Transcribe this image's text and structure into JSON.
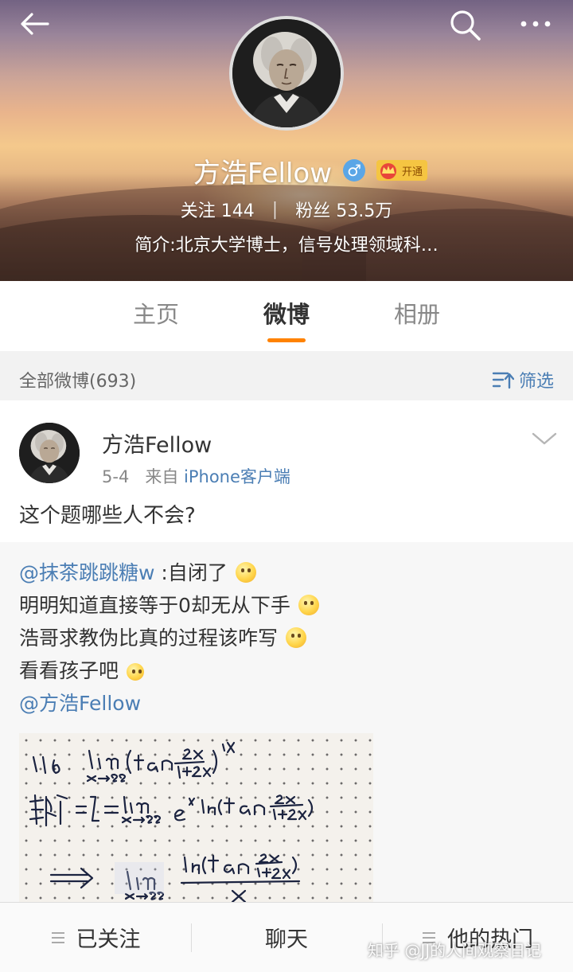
{
  "header": {
    "back_icon": "arrow-left-icon",
    "search_icon": "search-icon",
    "more_icon": "more-horizontal-icon",
    "user_name": "方浩Fellow",
    "gender_symbol": "♂",
    "vip_label": "开通",
    "following_label": "关注",
    "following_count": "144",
    "divider": "|",
    "followers_label": "粉丝",
    "followers_count": "53.5万",
    "bio": "简介:北京大学博士，信号处理领域科…"
  },
  "tabs": [
    {
      "label": "主页",
      "active": false
    },
    {
      "label": "微博",
      "active": true
    },
    {
      "label": "相册",
      "active": false
    }
  ],
  "filter": {
    "all_posts_label": "全部微博(693)",
    "filter_label": "筛选"
  },
  "post": {
    "author": "方浩Fellow",
    "date": "5-4",
    "source_prefix": "来自",
    "source": "iPhone客户端",
    "text": "这个题哪些人不会?",
    "repost": {
      "mention_user": "@抹茶跳跳糖w",
      "line1_text": ":自闭了",
      "line2": "明明知道直接等于0却无从下手",
      "line3": "浩哥求教伪比真的过程该咋写",
      "line4": "看看孩子吧",
      "mention_author": "@方浩Fellow"
    },
    "image": {
      "line1": "1.16. lim (tan 2πx/(1+2x))^(1/x)",
      "line1_sub": "x→∞",
      "line2": "解: I = lim e^(1/x · ln(tan πx/(1+2x)))",
      "line2_sub": "x→∞",
      "line3": "⇒ lim ln(tan πx/(1+2x)) / x",
      "line3_sub": "x→∞"
    }
  },
  "bottom_bar": {
    "followed_label": "已关注",
    "chat_label": "聊天",
    "hot_label": "他的热门"
  },
  "watermark": "知乎 @JJ的人间观察日记",
  "colors": {
    "accent": "#ff8200",
    "link": "#4b7eb4",
    "vip": "#f5c542"
  }
}
